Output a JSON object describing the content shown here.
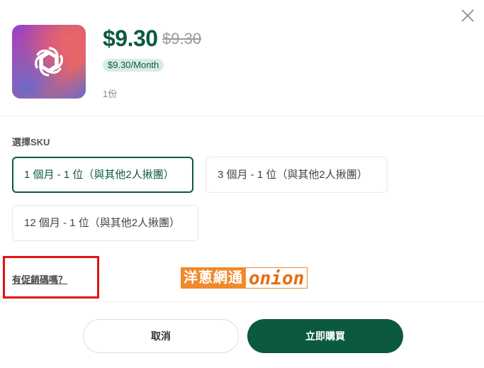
{
  "product": {
    "image_icon": "openai-logo-icon",
    "price_current": "$9.30",
    "price_original": "$9.30",
    "price_per_month": "$9.30/Month",
    "quantity": "1份"
  },
  "sku": {
    "title": "選擇SKU",
    "options": [
      {
        "label": "1 個月 - 1 位（與其他2人揪團）",
        "selected": true
      },
      {
        "label": "3 個月 - 1 位（與其他2人揪團）",
        "selected": false
      },
      {
        "label": "12 個月 - 1 位（與其他2人揪團）",
        "selected": false
      }
    ]
  },
  "promo": {
    "link_label": "有促銷碼嗎？",
    "highlight_color": "#e01414"
  },
  "watermark": {
    "chinese": "洋蔥網通",
    "english": "onion"
  },
  "footer": {
    "cancel_label": "取消",
    "buy_label": "立即購買"
  },
  "colors": {
    "brand_green": "#0b5a3e",
    "badge_bg": "#d6ede2",
    "watermark_orange": "#f08a2a"
  },
  "icons": {
    "close": "close-icon"
  }
}
